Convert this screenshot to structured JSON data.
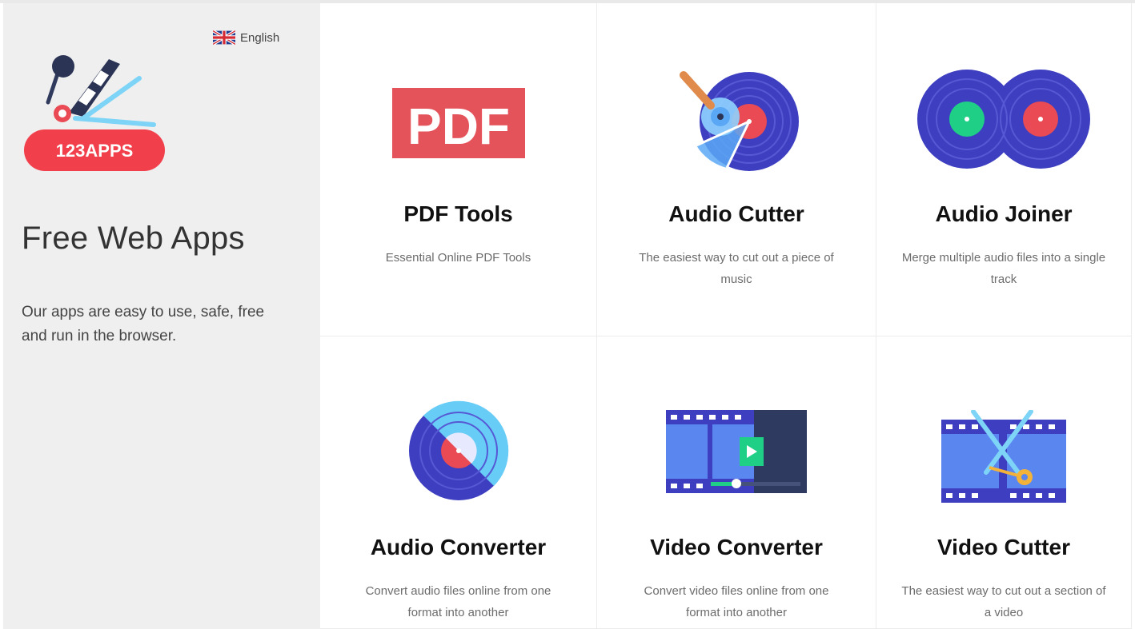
{
  "language": {
    "label": "English",
    "flag": "uk-flag-icon"
  },
  "brand": {
    "logo_text": "123APPS"
  },
  "hero": {
    "title": "Free Web Apps",
    "subtitle": "Our apps are easy to use, safe, free and run in the browser."
  },
  "apps": [
    {
      "name": "PDF Tools",
      "description": "Essential Online PDF Tools",
      "icon": "pdf-icon",
      "icon_text": "PDF"
    },
    {
      "name": "Audio Cutter",
      "description": "The easiest way to cut out a piece of music",
      "icon": "audio-cutter-icon"
    },
    {
      "name": "Audio Joiner",
      "description": "Merge multiple audio files into a single track",
      "icon": "audio-joiner-icon"
    },
    {
      "name": "Audio Converter",
      "description": "Convert audio files online from one format into another",
      "icon": "audio-converter-icon"
    },
    {
      "name": "Video Converter",
      "description": "Convert video files online from one format into another",
      "icon": "video-converter-icon"
    },
    {
      "name": "Video Cutter",
      "description": "The easiest way to cut out a section of a video",
      "icon": "video-cutter-icon"
    }
  ],
  "colors": {
    "accent_red": "#e94a53",
    "vinyl_blue": "#3d3fc0",
    "sidebar_bg": "#efefef"
  }
}
